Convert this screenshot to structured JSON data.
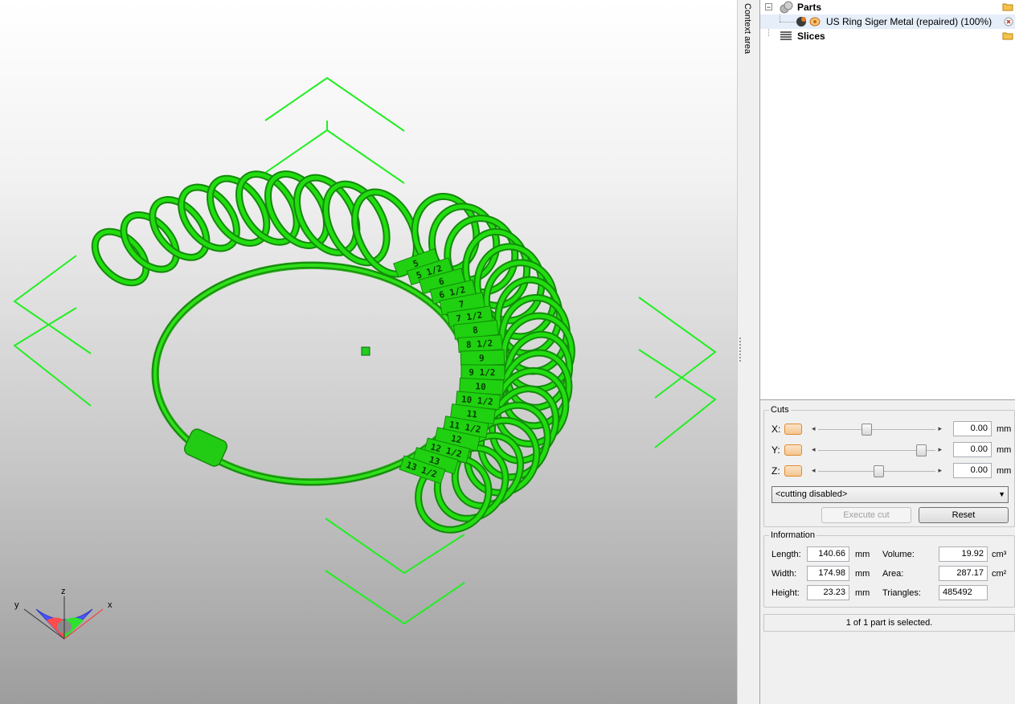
{
  "context_label": "Context area",
  "tree": {
    "parts_label": "Parts",
    "part_item": "US Ring Siger Metal (repaired) (100%)",
    "slices_label": "Slices"
  },
  "cuts": {
    "title": "Cuts",
    "x_label": "X:",
    "y_label": "Y:",
    "z_label": "Z:",
    "x_value": "0.00",
    "y_value": "0.00",
    "z_value": "0.00",
    "unit": "mm",
    "mode": "<cutting disabled>",
    "execute_label": "Execute cut",
    "reset_label": "Reset"
  },
  "info": {
    "title": "Information",
    "length_label": "Length:",
    "length": "140.66",
    "width_label": "Width:",
    "width": "174.98",
    "height_label": "Height:",
    "height": "23.23",
    "volume_label": "Volume:",
    "volume": "19.92",
    "area_label": "Area:",
    "area": "287.17",
    "triangles_label": "Triangles:",
    "triangles": "485492",
    "mm": "mm",
    "cm3": "cm³",
    "cm2": "cm²"
  },
  "status": "1 of 1 part is selected.",
  "viewport": {
    "axis_x": "x",
    "axis_y": "y",
    "axis_z": "z",
    "ring_sizes": [
      "5",
      "5 1/2",
      "6",
      "6 1/2",
      "7",
      "7 1/2",
      "8",
      "8 1/2",
      "9",
      "9 1/2",
      "10",
      "10 1/2",
      "11",
      "11 1/2",
      "12",
      "12 1/2",
      "13",
      "13 1/2"
    ],
    "model_color": "#22dd10",
    "gizmo_color": "#00ff00"
  }
}
